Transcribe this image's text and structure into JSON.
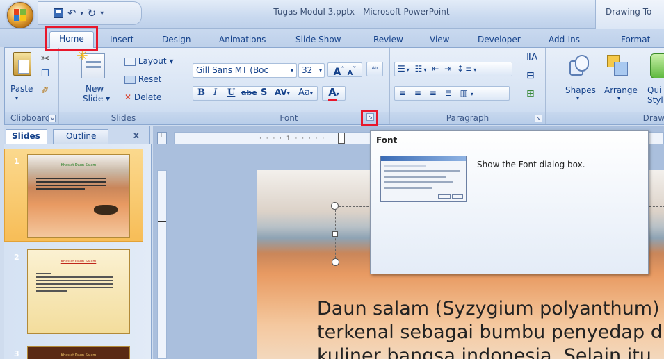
{
  "window": {
    "title": "Tugas Modul 3.pptx - Microsoft PowerPoint",
    "context_tab_group": "Drawing To"
  },
  "tabs": [
    "Home",
    "Insert",
    "Design",
    "Animations",
    "Slide Show",
    "Review",
    "View",
    "Developer",
    "Add-Ins",
    "Format"
  ],
  "ribbon": {
    "clipboard": {
      "paste": "Paste",
      "label": "Clipboard"
    },
    "slides": {
      "new_slide_1": "New",
      "new_slide_2": "Slide",
      "layout": "Layout",
      "reset": "Reset",
      "delete": "Delete",
      "label": "Slides"
    },
    "font": {
      "family": "Gill Sans MT (Boc",
      "size": "32",
      "bold": "B",
      "italic": "I",
      "underline": "U",
      "strike": "abe",
      "shadow": "S",
      "spacing": "AV",
      "case": "Aa",
      "grow": "A",
      "shrink": "A",
      "color": "A",
      "label": "Font"
    },
    "paragraph": {
      "label": "Paragraph"
    },
    "drawing": {
      "shapes": "Shapes",
      "arrange": "Arrange",
      "quick_styles_1": "Qui",
      "quick_styles_2": "Styl",
      "label": "Draw"
    }
  },
  "pane": {
    "tab_slides": "Slides",
    "tab_outline": "Outline",
    "close": "x"
  },
  "thumbnails": [
    {
      "num": "1",
      "title": "Khasiat Daun Salam"
    },
    {
      "num": "2",
      "title": "Khasiat Daun Salam"
    },
    {
      "num": "3",
      "title": "Khasiat Daun Salam"
    }
  ],
  "slide": {
    "lines": [
      "Daun salam (Syzygium polyanthum) s",
      "terkenal sebagai bumbu penyedap di",
      "kuliner bangsa indonesia. Selain itu, s"
    ]
  },
  "tooltip": {
    "title": "Font",
    "description": "Show the Font dialog box."
  },
  "colors": {
    "highlight": "#e8172b",
    "font_color": "#e8172b"
  }
}
